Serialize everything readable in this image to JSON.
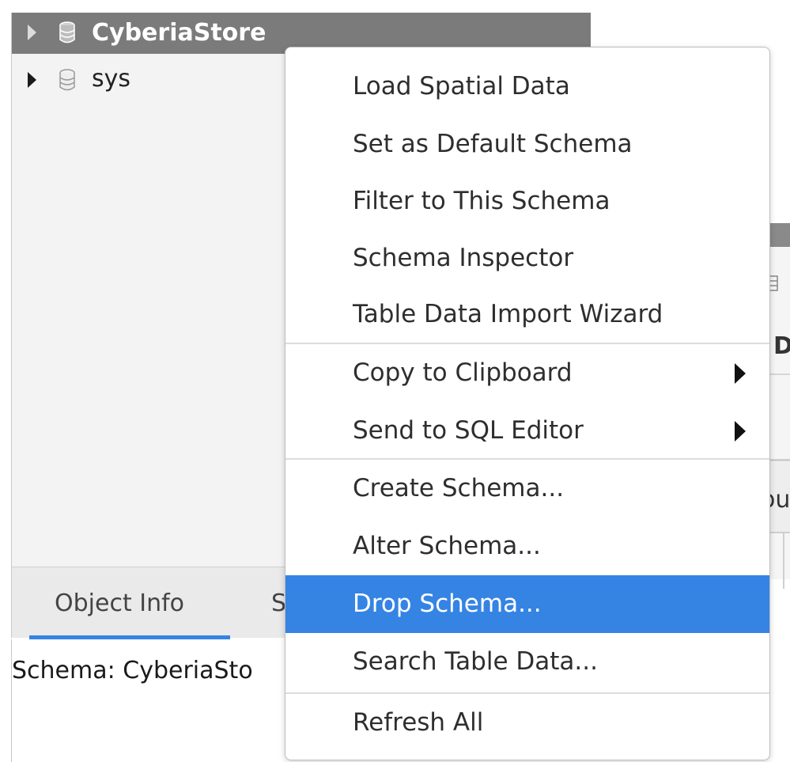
{
  "navigator": {
    "schemas": [
      {
        "label": "CyberiaStore",
        "selected": true
      },
      {
        "label": "sys",
        "selected": false
      }
    ]
  },
  "info_panel": {
    "tabs": [
      {
        "label": "Object Info",
        "active": true
      },
      {
        "label": "S",
        "active": false
      }
    ],
    "content": "Schema: CyberiaSto"
  },
  "background_fragments": {
    "header_letter": "D",
    "button_fragment": "ou"
  },
  "context_menu": {
    "items": [
      {
        "label": "Load Spatial Data"
      },
      {
        "label": "Set as Default Schema"
      },
      {
        "label": "Filter to This Schema"
      },
      {
        "label": "Schema Inspector"
      },
      {
        "label": "Table Data Import Wizard"
      },
      {
        "label": "Copy to Clipboard",
        "submenu": true
      },
      {
        "label": "Send to SQL Editor",
        "submenu": true
      },
      {
        "label": "Create Schema..."
      },
      {
        "label": "Alter Schema..."
      },
      {
        "label": "Drop Schema...",
        "highlighted": true
      },
      {
        "label": "Search Table Data..."
      },
      {
        "label": "Refresh All"
      }
    ]
  },
  "colors": {
    "selection_gray": "#7b7b7b",
    "highlight_blue": "#3584e4",
    "panel_bg": "#f3f3f3"
  }
}
